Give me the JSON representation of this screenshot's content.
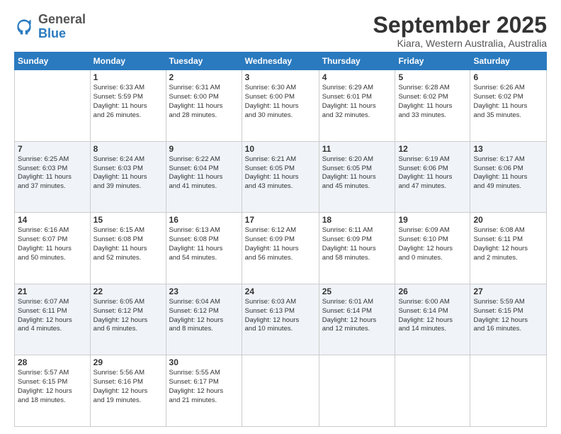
{
  "logo": {
    "general": "General",
    "blue": "Blue"
  },
  "title": "September 2025",
  "subtitle": "Kiara, Western Australia, Australia",
  "headers": [
    "Sunday",
    "Monday",
    "Tuesday",
    "Wednesday",
    "Thursday",
    "Friday",
    "Saturday"
  ],
  "weeks": [
    [
      {
        "day": "",
        "info": ""
      },
      {
        "day": "1",
        "info": "Sunrise: 6:33 AM\nSunset: 5:59 PM\nDaylight: 11 hours\nand 26 minutes."
      },
      {
        "day": "2",
        "info": "Sunrise: 6:31 AM\nSunset: 6:00 PM\nDaylight: 11 hours\nand 28 minutes."
      },
      {
        "day": "3",
        "info": "Sunrise: 6:30 AM\nSunset: 6:00 PM\nDaylight: 11 hours\nand 30 minutes."
      },
      {
        "day": "4",
        "info": "Sunrise: 6:29 AM\nSunset: 6:01 PM\nDaylight: 11 hours\nand 32 minutes."
      },
      {
        "day": "5",
        "info": "Sunrise: 6:28 AM\nSunset: 6:02 PM\nDaylight: 11 hours\nand 33 minutes."
      },
      {
        "day": "6",
        "info": "Sunrise: 6:26 AM\nSunset: 6:02 PM\nDaylight: 11 hours\nand 35 minutes."
      }
    ],
    [
      {
        "day": "7",
        "info": "Sunrise: 6:25 AM\nSunset: 6:03 PM\nDaylight: 11 hours\nand 37 minutes."
      },
      {
        "day": "8",
        "info": "Sunrise: 6:24 AM\nSunset: 6:03 PM\nDaylight: 11 hours\nand 39 minutes."
      },
      {
        "day": "9",
        "info": "Sunrise: 6:22 AM\nSunset: 6:04 PM\nDaylight: 11 hours\nand 41 minutes."
      },
      {
        "day": "10",
        "info": "Sunrise: 6:21 AM\nSunset: 6:05 PM\nDaylight: 11 hours\nand 43 minutes."
      },
      {
        "day": "11",
        "info": "Sunrise: 6:20 AM\nSunset: 6:05 PM\nDaylight: 11 hours\nand 45 minutes."
      },
      {
        "day": "12",
        "info": "Sunrise: 6:19 AM\nSunset: 6:06 PM\nDaylight: 11 hours\nand 47 minutes."
      },
      {
        "day": "13",
        "info": "Sunrise: 6:17 AM\nSunset: 6:06 PM\nDaylight: 11 hours\nand 49 minutes."
      }
    ],
    [
      {
        "day": "14",
        "info": "Sunrise: 6:16 AM\nSunset: 6:07 PM\nDaylight: 11 hours\nand 50 minutes."
      },
      {
        "day": "15",
        "info": "Sunrise: 6:15 AM\nSunset: 6:08 PM\nDaylight: 11 hours\nand 52 minutes."
      },
      {
        "day": "16",
        "info": "Sunrise: 6:13 AM\nSunset: 6:08 PM\nDaylight: 11 hours\nand 54 minutes."
      },
      {
        "day": "17",
        "info": "Sunrise: 6:12 AM\nSunset: 6:09 PM\nDaylight: 11 hours\nand 56 minutes."
      },
      {
        "day": "18",
        "info": "Sunrise: 6:11 AM\nSunset: 6:09 PM\nDaylight: 11 hours\nand 58 minutes."
      },
      {
        "day": "19",
        "info": "Sunrise: 6:09 AM\nSunset: 6:10 PM\nDaylight: 12 hours\nand 0 minutes."
      },
      {
        "day": "20",
        "info": "Sunrise: 6:08 AM\nSunset: 6:11 PM\nDaylight: 12 hours\nand 2 minutes."
      }
    ],
    [
      {
        "day": "21",
        "info": "Sunrise: 6:07 AM\nSunset: 6:11 PM\nDaylight: 12 hours\nand 4 minutes."
      },
      {
        "day": "22",
        "info": "Sunrise: 6:05 AM\nSunset: 6:12 PM\nDaylight: 12 hours\nand 6 minutes."
      },
      {
        "day": "23",
        "info": "Sunrise: 6:04 AM\nSunset: 6:12 PM\nDaylight: 12 hours\nand 8 minutes."
      },
      {
        "day": "24",
        "info": "Sunrise: 6:03 AM\nSunset: 6:13 PM\nDaylight: 12 hours\nand 10 minutes."
      },
      {
        "day": "25",
        "info": "Sunrise: 6:01 AM\nSunset: 6:14 PM\nDaylight: 12 hours\nand 12 minutes."
      },
      {
        "day": "26",
        "info": "Sunrise: 6:00 AM\nSunset: 6:14 PM\nDaylight: 12 hours\nand 14 minutes."
      },
      {
        "day": "27",
        "info": "Sunrise: 5:59 AM\nSunset: 6:15 PM\nDaylight: 12 hours\nand 16 minutes."
      }
    ],
    [
      {
        "day": "28",
        "info": "Sunrise: 5:57 AM\nSunset: 6:15 PM\nDaylight: 12 hours\nand 18 minutes."
      },
      {
        "day": "29",
        "info": "Sunrise: 5:56 AM\nSunset: 6:16 PM\nDaylight: 12 hours\nand 19 minutes."
      },
      {
        "day": "30",
        "info": "Sunrise: 5:55 AM\nSunset: 6:17 PM\nDaylight: 12 hours\nand 21 minutes."
      },
      {
        "day": "",
        "info": ""
      },
      {
        "day": "",
        "info": ""
      },
      {
        "day": "",
        "info": ""
      },
      {
        "day": "",
        "info": ""
      }
    ]
  ]
}
